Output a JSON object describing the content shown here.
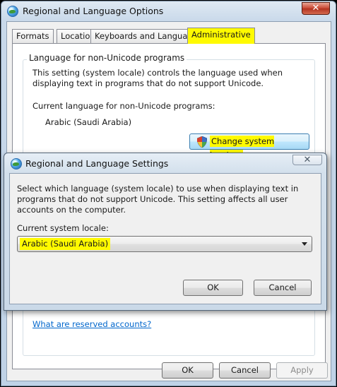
{
  "window": {
    "title": "Regional and Language Options",
    "close_glyph": "✕",
    "tabs": [
      "Formats",
      "Location",
      "Keyboards and Languages",
      "Administrative"
    ],
    "active_tab": "Administrative",
    "group_title": "Language for non-Unicode programs",
    "description": "This setting (system locale) controls the language used when displaying text in programs that do not support Unicode.",
    "current_label": "Current language for non-Unicode programs:",
    "current_value": "Arabic (Saudi Arabia)",
    "change_button": "Change system locale...",
    "reserved_link": "What are reserved accounts?",
    "buttons": {
      "ok": "OK",
      "cancel": "Cancel",
      "apply": "Apply"
    }
  },
  "dialog": {
    "title": "Regional and Language Settings",
    "close_glyph": "✕",
    "description": "Select which language (system locale) to use when displaying text in programs that do not support Unicode. This setting affects all user accounts on the computer.",
    "locale_label": "Current system locale:",
    "locale_value": "Arabic (Saudi Arabia)",
    "buttons": {
      "ok": "OK",
      "cancel": "Cancel"
    }
  },
  "colors": {
    "highlight": "#fffa00",
    "link": "#0066cc",
    "close_red": "#c7442f"
  },
  "icons": [
    "globe-icon",
    "close-icon",
    "shield-icon",
    "chevron-down-icon"
  ]
}
